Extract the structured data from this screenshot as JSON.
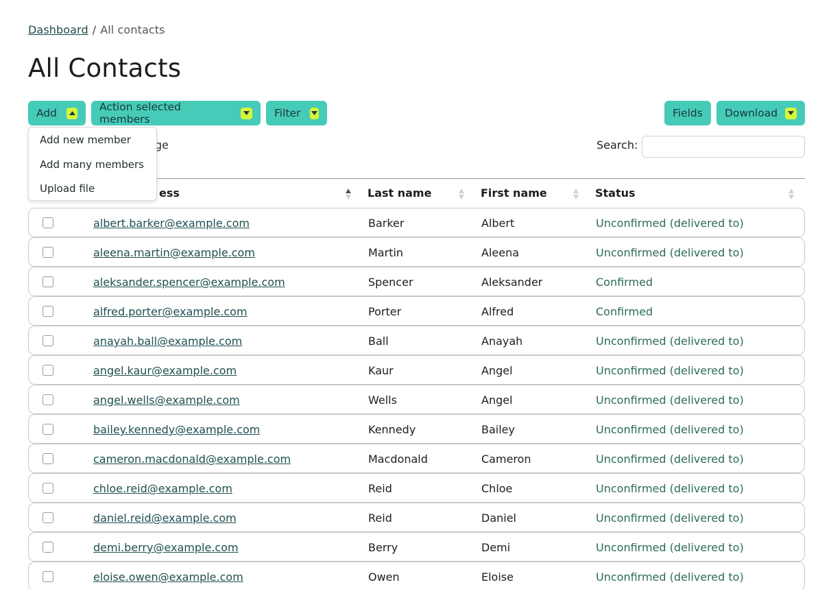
{
  "breadcrumb": {
    "dashboard": "Dashboard",
    "separator": "/",
    "current": "All contacts"
  },
  "page_title": "All Contacts",
  "toolbar": {
    "add_label": "Add",
    "action_label": "Action selected members",
    "filter_label": "Filter",
    "fields_label": "Fields",
    "download_label": "Download"
  },
  "add_menu": {
    "items": [
      "Add new member",
      "Add many members",
      "Upload file"
    ]
  },
  "per_page_partial": "ge",
  "search": {
    "label": "Search:",
    "value": ""
  },
  "columns": {
    "email_partial": "ess",
    "last_name": "Last name",
    "first_name": "First name",
    "status": "Status"
  },
  "rows": [
    {
      "email": "albert.barker@example.com",
      "last": "Barker",
      "first": "Albert",
      "status": "Unconfirmed (delivered to)"
    },
    {
      "email": "aleena.martin@example.com",
      "last": "Martin",
      "first": "Aleena",
      "status": "Unconfirmed (delivered to)"
    },
    {
      "email": "aleksander.spencer@example.com",
      "last": "Spencer",
      "first": "Aleksander",
      "status": "Confirmed"
    },
    {
      "email": "alfred.porter@example.com",
      "last": "Porter",
      "first": "Alfred",
      "status": "Confirmed"
    },
    {
      "email": "anayah.ball@example.com",
      "last": "Ball",
      "first": "Anayah",
      "status": "Unconfirmed (delivered to)"
    },
    {
      "email": "angel.kaur@example.com",
      "last": "Kaur",
      "first": "Angel",
      "status": "Unconfirmed (delivered to)"
    },
    {
      "email": "angel.wells@example.com",
      "last": "Wells",
      "first": "Angel",
      "status": "Unconfirmed (delivered to)"
    },
    {
      "email": "bailey.kennedy@example.com",
      "last": "Kennedy",
      "first": "Bailey",
      "status": "Unconfirmed (delivered to)"
    },
    {
      "email": "cameron.macdonald@example.com",
      "last": "Macdonald",
      "first": "Cameron",
      "status": "Unconfirmed (delivered to)"
    },
    {
      "email": "chloe.reid@example.com",
      "last": "Reid",
      "first": "Chloe",
      "status": "Unconfirmed (delivered to)"
    },
    {
      "email": "daniel.reid@example.com",
      "last": "Reid",
      "first": "Daniel",
      "status": "Unconfirmed (delivered to)"
    },
    {
      "email": "demi.berry@example.com",
      "last": "Berry",
      "first": "Demi",
      "status": "Unconfirmed (delivered to)"
    },
    {
      "email": "eloise.owen@example.com",
      "last": "Owen",
      "first": "Eloise",
      "status": "Unconfirmed (delivered to)"
    }
  ],
  "colors": {
    "button_bg": "#46cbb8",
    "caret_bg": "#d8f53a",
    "status_text": "#2b6b5b",
    "link_text": "#1f4f4f"
  }
}
